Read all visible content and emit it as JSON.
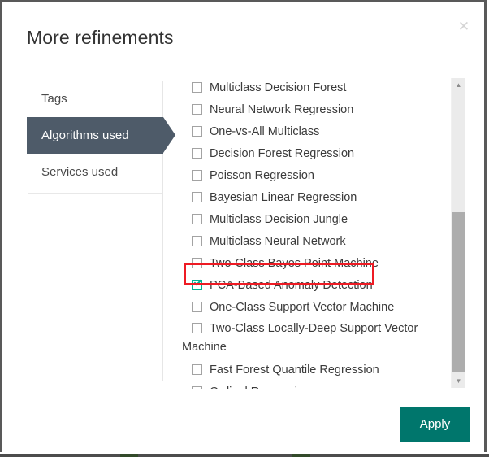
{
  "dialog": {
    "title": "More refinements",
    "close_icon": "close-icon",
    "close_glyph": "✕"
  },
  "tabs": [
    {
      "label": "Tags",
      "selected": false
    },
    {
      "label": "Algorithms used",
      "selected": true
    },
    {
      "label": "Services used",
      "selected": false
    }
  ],
  "algorithms": [
    {
      "label": "Multiclass Decision Forest",
      "checked": false,
      "wrapped": false
    },
    {
      "label": "Neural Network Regression",
      "checked": false,
      "wrapped": false
    },
    {
      "label": "One-vs-All Multiclass",
      "checked": false,
      "wrapped": false
    },
    {
      "label": "Decision Forest Regression",
      "checked": false,
      "wrapped": false
    },
    {
      "label": "Poisson Regression",
      "checked": false,
      "wrapped": false
    },
    {
      "label": "Bayesian Linear Regression",
      "checked": false,
      "wrapped": false
    },
    {
      "label": "Multiclass Decision Jungle",
      "checked": false,
      "wrapped": false
    },
    {
      "label": "Multiclass Neural Network",
      "checked": false,
      "wrapped": false
    },
    {
      "label": "Two-Class Bayes Point Machine",
      "checked": false,
      "wrapped": false
    },
    {
      "label": "PCA-Based Anomaly Detection",
      "checked": true,
      "wrapped": false
    },
    {
      "label": "One-Class Support Vector Machine",
      "checked": false,
      "wrapped": false
    },
    {
      "label": "Two-Class Locally-Deep Support Vector Machine",
      "checked": false,
      "wrapped": true
    },
    {
      "label": "Fast Forest Quantile Regression",
      "checked": false,
      "wrapped": false
    },
    {
      "label": "Ordinal Regression",
      "checked": false,
      "wrapped": false
    }
  ],
  "scrollbar": {
    "up_glyph": "▲",
    "down_glyph": "▼"
  },
  "footer": {
    "apply_label": "Apply"
  },
  "colors": {
    "accent_teal": "#00766c",
    "checkbox_teal": "#00b294",
    "tab_selected": "#4e5b69",
    "highlight_red": "#ee1b24",
    "scrollbar_thumb": "#adadad",
    "scrollbar_track": "#ebebeb",
    "dialog_border": "#595959",
    "text_primary": "#333333"
  }
}
